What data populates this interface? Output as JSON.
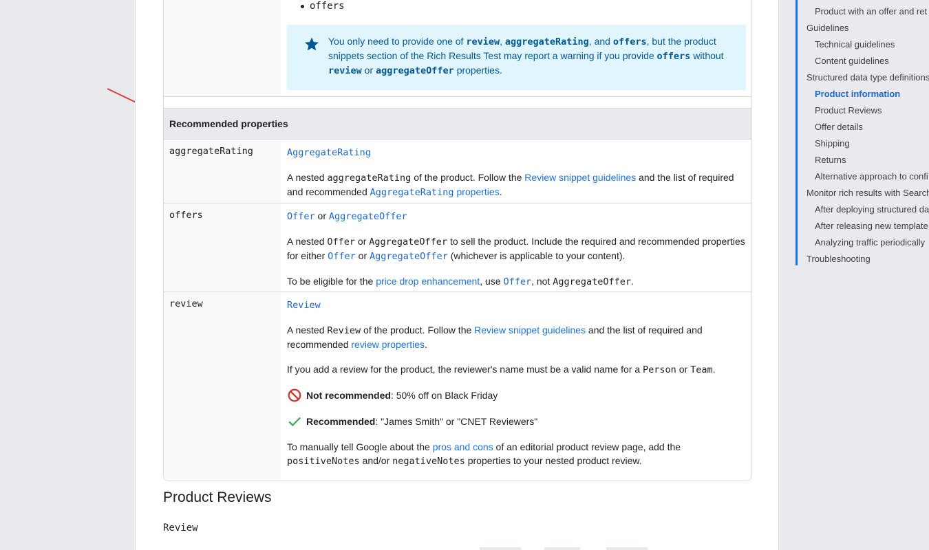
{
  "table": {
    "partial_bullet": "offers",
    "note": {
      "p1": "You only need to provide one of ",
      "c1": "review",
      "p2": ", ",
      "c2": "aggregateRating",
      "p3": ", and ",
      "c3": "offers",
      "p4": ", but the product snippets section of the Rich Results Test may report a warning if you provide ",
      "c4": "offers",
      "p5": " without ",
      "c5": "review",
      "p6": " or ",
      "c6": "aggregateOffer",
      "p7": " properties."
    },
    "section_title": "Recommended properties",
    "aggregateRating": {
      "key": "aggregateRating",
      "type": "AggregateRating",
      "d1": "A nested ",
      "d1_code": "aggregateRating",
      "d2": " of the product. Follow the ",
      "d2_link": "Review snippet guidelines",
      "d3": " and the list of required and recommended ",
      "d3_link_code": "AggregateRating",
      "d3_link": " properties",
      "d4": "."
    },
    "offers": {
      "key": "offers",
      "type1": "Offer",
      "or": " or ",
      "type2": "AggregateOffer",
      "d1": "A nested ",
      "d1_code": "Offer",
      "d1_or": " or ",
      "d1_code2": "AggregateOffer",
      "d2": " to sell the product. Include the required and recommended properties for either ",
      "d2_link1": "Offer",
      "d2_or": " or ",
      "d2_link2": "AggregateOffer",
      "d3": " (whichever is applicable to your content).",
      "e1": "To be eligible for the ",
      "e1_link": "price drop enhancement",
      "e2": ", use ",
      "e2_link_code": "Offer",
      "e3": ", not ",
      "e3_code": "AggregateOffer",
      "e4": "."
    },
    "review": {
      "key": "review",
      "type": "Review",
      "d1": "A nested ",
      "d1_code": "Review",
      "d2": " of the product. Follow the ",
      "d2_link": "Review snippet guidelines",
      "d3": " and the list of required and recommended ",
      "d3_link": "review properties",
      "d4": ".",
      "n1": "If you add a review for the product, the reviewer's name must be a valid name for a ",
      "n1_code": "Person",
      "n1_or": " or ",
      "n1_code2": "Team",
      "n1_end": ".",
      "not_rec_label": "Not recommended",
      "not_rec_text": ": 50% off on Black Friday",
      "rec_label": "Recommended",
      "rec_text": ": \"James Smith\" or \"CNET Reviewers\"",
      "m1": "To manually tell Google about the ",
      "m1_link": "pros and cons",
      "m2": " of an editorial product review page, add the ",
      "m2_code": "positiveNotes",
      "m3": " and/or ",
      "m3_code": "negativeNotes",
      "m4": " properties to your nested product review."
    }
  },
  "below": {
    "heading": "Product Reviews",
    "code": "Review"
  },
  "toc": {
    "items": [
      {
        "label": "Product with an offer and ret",
        "indent": 2
      },
      {
        "label": "Guidelines",
        "indent": 1
      },
      {
        "label": "Technical guidelines",
        "indent": 2
      },
      {
        "label": "Content guidelines",
        "indent": 2
      },
      {
        "label": "Structured data type definitions",
        "indent": 1
      },
      {
        "label": "Product information",
        "indent": 2,
        "active": true
      },
      {
        "label": "Product Reviews",
        "indent": 2
      },
      {
        "label": "Offer details",
        "indent": 2
      },
      {
        "label": "Shipping",
        "indent": 2
      },
      {
        "label": "Returns",
        "indent": 2
      },
      {
        "label": "Alternative approach to confi",
        "indent": 2
      },
      {
        "label": "Monitor rich results with Search",
        "indent": 1
      },
      {
        "label": "After deploying structured da",
        "indent": 2
      },
      {
        "label": "After releasing new template",
        "indent": 2
      },
      {
        "label": "Analyzing traffic periodically",
        "indent": 2
      },
      {
        "label": "Troubleshooting",
        "indent": 1
      }
    ]
  },
  "colors": {
    "link": "#1a73e8",
    "note_bg": "#e1f5fe",
    "note_text": "#01579b",
    "annotation_arrow": "#e53935",
    "check": "#34a853",
    "prohibited": "#d93025"
  },
  "icons": [
    "star-icon",
    "prohibited-icon",
    "checkmark-icon",
    "annotation-arrow"
  ]
}
